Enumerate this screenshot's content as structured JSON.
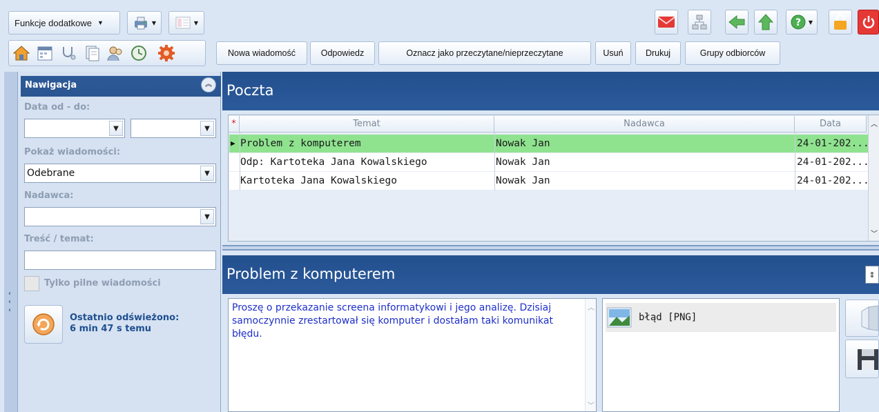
{
  "toolbar": {
    "functions_label": "Funkcje dodatkowe",
    "actions": [
      "Nowa wiadomość",
      "Odpowiedz",
      "Oznacz jako przeczytane/nieprzeczytane",
      "Usuń",
      "Drukuj",
      "Grupy odbiorców"
    ]
  },
  "nav": {
    "title": "Nawigacja",
    "date_label": "Data od - do:",
    "show_label": "Pokaż wiadomości:",
    "show_value": "Odebrane",
    "sender_label": "Nadawca:",
    "content_label": "Treść / temat:",
    "urgent_label": "Tylko pilne wiadomości",
    "refresh_title": "Ostatnio odświeżono:",
    "refresh_time": "6 min 47 s temu"
  },
  "mail": {
    "title": "Poczta",
    "columns": [
      "Temat",
      "Nadawca",
      "Data"
    ],
    "flag_column": "*",
    "rows": [
      {
        "subject": "Problem z komputerem",
        "sender": "Nowak Jan",
        "date": "24-01-202..."
      },
      {
        "subject": "Odp: Kartoteka Jana Kowalskiego",
        "sender": "Nowak Jan",
        "date": "24-01-202..."
      },
      {
        "subject": "Kartoteka Jana Kowalskiego",
        "sender": "Nowak Jan",
        "date": "24-01-202..."
      }
    ]
  },
  "preview": {
    "title": "Problem z komputerem",
    "body": "Proszę o przekazanie screena informatykowi i jego analizę. Dzisiaj samoczynnie zrestartował się komputer i dostałam taki komunikat błędu.",
    "attachment": "błąd [PNG]"
  },
  "colors": {
    "header_blue": "#2d5a98",
    "selected_row": "#8fe38f",
    "body_text": "#1e2fc8"
  }
}
